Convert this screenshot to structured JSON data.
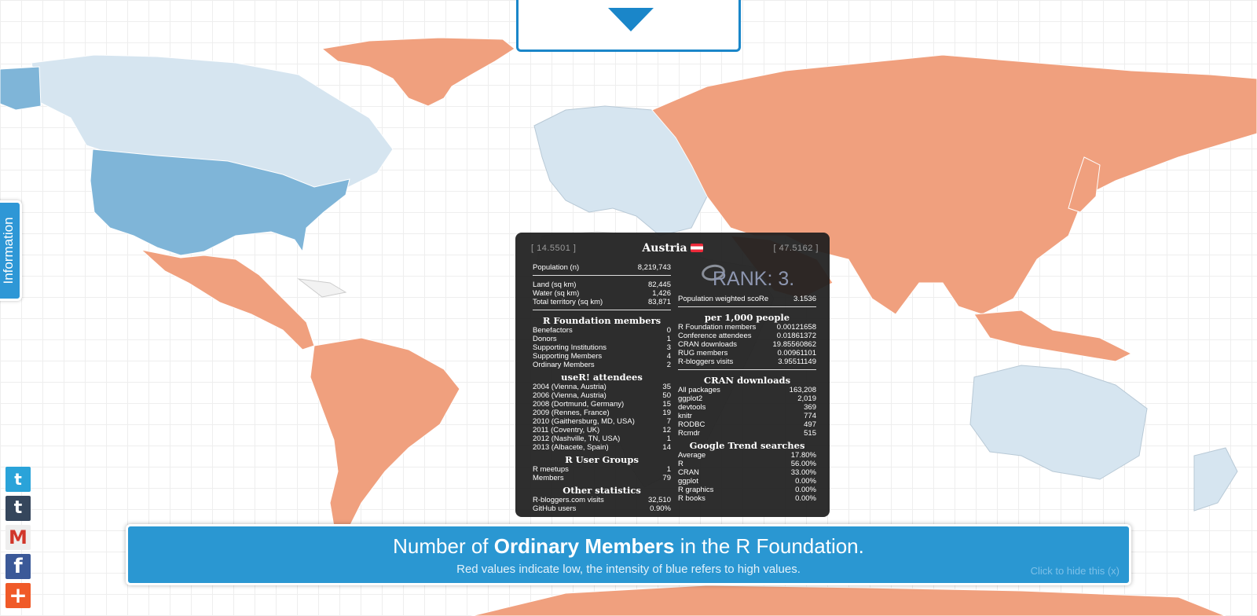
{
  "info_tab": {
    "label": "Information"
  },
  "tooltip": {
    "coord_left": "[ 14.5501 ]",
    "coord_right": "[ 47.5162 ]",
    "country": "Austria",
    "rank": "RANK: 3.",
    "population": {
      "label": "Population (n)",
      "value": "8,219,743"
    },
    "area": [
      {
        "label": "Land (sq km)",
        "value": "82,445"
      },
      {
        "label": "Water (sq km)",
        "value": "1,426"
      },
      {
        "label": "Total territory (sq km)",
        "value": "83,871"
      }
    ],
    "rf_title": "R Foundation members",
    "rf": [
      {
        "label": "Benefactors",
        "value": "0"
      },
      {
        "label": "Donors",
        "value": "1"
      },
      {
        "label": "Supporting Institutions",
        "value": "3"
      },
      {
        "label": "Supporting Members",
        "value": "4"
      },
      {
        "label": "Ordinary Members",
        "value": "2"
      }
    ],
    "user_title": "useR! attendees",
    "user": [
      {
        "label": "2004 (Vienna, Austria)",
        "value": "35"
      },
      {
        "label": "2006 (Vienna, Austria)",
        "value": "50"
      },
      {
        "label": "2008 (Dortmund, Germany)",
        "value": "15"
      },
      {
        "label": "2009 (Rennes, France)",
        "value": "19"
      },
      {
        "label": "2010 (Gaithersburg, MD, USA)",
        "value": "7"
      },
      {
        "label": "2011 (Coventry, UK)",
        "value": "12"
      },
      {
        "label": "2012 (Nashville, TN, USA)",
        "value": "1"
      },
      {
        "label": "2013 (Albacete, Spain)",
        "value": "14"
      }
    ],
    "rug_title": "R User Groups",
    "rug": [
      {
        "label": "R meetups",
        "value": "1"
      },
      {
        "label": "Members",
        "value": "79"
      }
    ],
    "other_title": "Other statistics",
    "other": [
      {
        "label": "R-bloggers.com visits",
        "value": "32,510"
      },
      {
        "label": "GitHub users",
        "value": "0.90%"
      }
    ],
    "score": {
      "label": "Population weighted scoRe",
      "value": "3.1536"
    },
    "per_title": "per 1,000 people",
    "per": [
      {
        "label": "R Foundation members",
        "value": "0.00121658"
      },
      {
        "label": "Conference attendees",
        "value": "0.01861372"
      },
      {
        "label": "CRAN downloads",
        "value": "19.85560862"
      },
      {
        "label": "RUG members",
        "value": "0.00961101"
      },
      {
        "label": "R-bloggers visits",
        "value": "3.95511149"
      }
    ],
    "cran_title": "CRAN downloads",
    "cran": [
      {
        "label": "All packages",
        "value": "163,208"
      },
      {
        "label": "ggplot2",
        "value": "2,019"
      },
      {
        "label": "devtools",
        "value": "369"
      },
      {
        "label": "knitr",
        "value": "774"
      },
      {
        "label": "RODBC",
        "value": "497"
      },
      {
        "label": "Rcmdr",
        "value": "515"
      }
    ],
    "trend_title": "Google Trend searches",
    "trend": [
      {
        "label": "Average",
        "value": "17.80%"
      },
      {
        "label": "R",
        "value": "56.00%"
      },
      {
        "label": "CRAN",
        "value": "33.00%"
      },
      {
        "label": "ggplot",
        "value": "0.00%"
      },
      {
        "label": "R graphics",
        "value": "0.00%"
      },
      {
        "label": "R books",
        "value": "0.00%"
      }
    ]
  },
  "banner": {
    "prefix": "Number of ",
    "bold": "Ordinary Members",
    "suffix": " in the R Foundation.",
    "subtitle": "Red values indicate low, the intensity of blue refers to high values.",
    "hide": "Click to hide this (x)"
  },
  "colors": {
    "low": "#f0a07e",
    "high": "#7fb5d8",
    "mid": "#d6e5f0",
    "none": "#f2f2f2"
  },
  "icons": [
    "twitter-icon",
    "tumblr-icon",
    "gmail-icon",
    "facebook-icon",
    "addthis-icon"
  ]
}
